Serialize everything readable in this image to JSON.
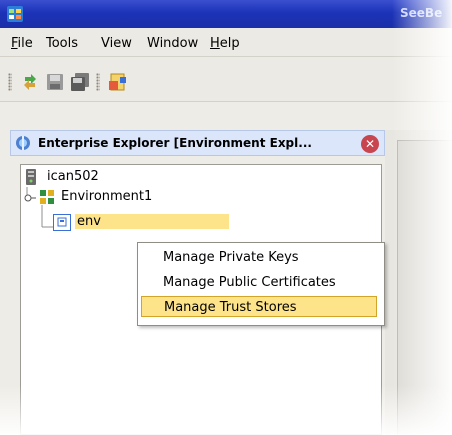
{
  "window": {
    "title": "SeeBe",
    "app_icon": "app-logo-icon"
  },
  "menu": {
    "items": [
      {
        "label_first": "F",
        "label_rest": "ile"
      },
      {
        "label_first": "",
        "label_rest": "Tools"
      },
      {
        "label_first": "",
        "label_rest": "View"
      },
      {
        "label_first": "",
        "label_rest": "Window"
      },
      {
        "label_first": "H",
        "label_rest": "elp"
      }
    ]
  },
  "toolbar": {
    "icons": [
      "refresh-icon",
      "save-icon",
      "save-all-icon",
      "configure-icon"
    ]
  },
  "panel": {
    "title": "Enterprise Explorer [Environment Expl...",
    "title_icon": "explorer-icon",
    "close_icon": "close-icon"
  },
  "tree": {
    "items": [
      {
        "label": "ican502",
        "icon": "server-icon"
      },
      {
        "label": "Environment1",
        "icon": "environment-icon",
        "expander": "collapse-icon"
      },
      {
        "label": "env",
        "icon": "object-icon",
        "selected": true
      }
    ]
  },
  "context_menu": {
    "items": [
      {
        "label": "Manage Private Keys",
        "active": false
      },
      {
        "label": "Manage Public Certificates",
        "active": false
      },
      {
        "label": "Manage Trust Stores",
        "active": true
      }
    ]
  },
  "colors": {
    "title_bar": "#1c33b8",
    "selection": "#fde48b",
    "selection_border": "#d2a52a",
    "panel_header": "#dbe6fb"
  }
}
